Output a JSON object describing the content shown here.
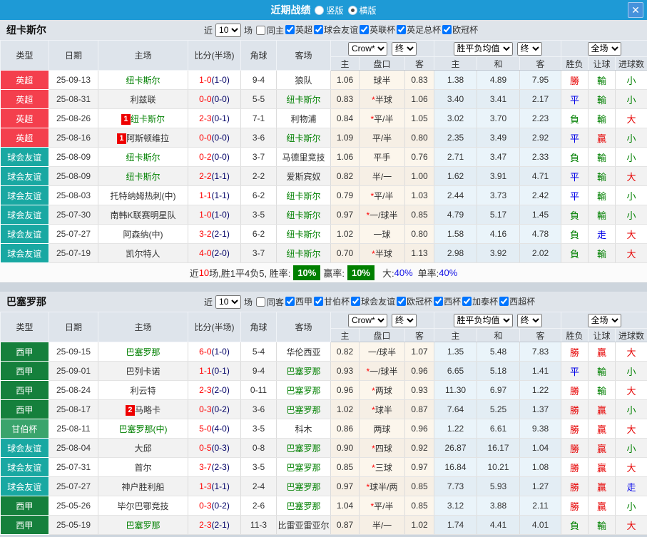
{
  "titlebar": {
    "title": "近期战绩",
    "vertical": "竖版",
    "horizontal": "横版",
    "close": "✕"
  },
  "colors": {
    "topbar_blue": "#1e9ad6",
    "epl_red": "#f43f4d",
    "friendly_teal": "#19a8a2",
    "laliga_green": "#15803c",
    "gamper_green": "#3aa46c",
    "win_red": "#e60000",
    "lose_green": "#008000",
    "draw_blue": "#0000e8"
  },
  "table_columns": {
    "main": [
      "类型",
      "日期",
      "主场",
      "比分(半场)",
      "角球",
      "客场"
    ],
    "sub": [
      "主",
      "盘口",
      "客",
      "主",
      "和",
      "客",
      "胜负",
      "让球",
      "进球数"
    ]
  },
  "sections": [
    {
      "team": "纽卡斯尔",
      "filter": {
        "near": "近",
        "count": "10",
        "unit": "场",
        "same": "同主",
        "leagues": [
          "英超",
          "球会友谊",
          "英联杯",
          "英足总杯",
          "欧冠杯"
        ]
      },
      "controls": {
        "bookmaker": "Crow*",
        "book_period": "终",
        "avg_label": "胜平负均值",
        "avg_period": "终",
        "scope": "全场"
      },
      "rows": [
        {
          "type": "英超",
          "type_color": "#f43f4d",
          "date": "25-09-13",
          "home": "纽卡斯尔",
          "home_green": true,
          "score": "1-0",
          "half": "(1-0)",
          "corner": "9-4",
          "away": "狼队",
          "away_green": false,
          "oh": "1.06",
          "hc": "球半",
          "oa": "0.83",
          "ah": "1.38",
          "ad": "4.89",
          "aa": "7.95",
          "res": "勝",
          "res_color": "#e60000",
          "let": "輸",
          "let_color": "#008000",
          "goal": "小",
          "goal_color": "#008000"
        },
        {
          "type": "英超",
          "type_color": "#f43f4d",
          "date": "25-08-31",
          "home": "利兹联",
          "home_green": false,
          "score": "0-0",
          "half": "(0-0)",
          "corner": "5-5",
          "away": "纽卡斯尔",
          "away_green": true,
          "oh": "0.83",
          "star": "*",
          "hc": "半球",
          "oa": "1.06",
          "ah": "3.40",
          "ad": "3.41",
          "aa": "2.17",
          "res": "平",
          "res_color": "#0000e8",
          "let": "輸",
          "let_color": "#008000",
          "goal": "小",
          "goal_color": "#008000"
        },
        {
          "type": "英超",
          "type_color": "#f43f4d",
          "date": "25-08-26",
          "badge": "1",
          "home": "纽卡斯尔",
          "home_green": true,
          "score": "2-3",
          "half": "(0-1)",
          "corner": "7-1",
          "away": "利物浦",
          "away_green": false,
          "oh": "0.84",
          "star": "*",
          "hc": "平/半",
          "oa": "1.05",
          "ah": "3.02",
          "ad": "3.70",
          "aa": "2.23",
          "res": "負",
          "res_color": "#008000",
          "let": "輸",
          "let_color": "#008000",
          "goal": "大",
          "goal_color": "#e60000"
        },
        {
          "type": "英超",
          "type_color": "#f43f4d",
          "date": "25-08-16",
          "badge": "1",
          "home": "阿斯顿维拉",
          "home_green": false,
          "score": "0-0",
          "half": "(0-0)",
          "corner": "3-6",
          "away": "纽卡斯尔",
          "away_green": true,
          "oh": "1.09",
          "hc": "平/半",
          "oa": "0.80",
          "ah": "2.35",
          "ad": "3.49",
          "aa": "2.92",
          "res": "平",
          "res_color": "#0000e8",
          "let": "贏",
          "let_color": "#e60000",
          "goal": "小",
          "goal_color": "#008000"
        },
        {
          "type": "球会友谊",
          "type_color": "#19a8a2",
          "date": "25-08-09",
          "home": "纽卡斯尔",
          "home_green": true,
          "score": "0-2",
          "half": "(0-0)",
          "corner": "3-7",
          "away": "马德里竞技",
          "away_green": false,
          "oh": "1.06",
          "hc": "平手",
          "oa": "0.76",
          "ah": "2.71",
          "ad": "3.47",
          "aa": "2.33",
          "res": "負",
          "res_color": "#008000",
          "let": "輸",
          "let_color": "#008000",
          "goal": "小",
          "goal_color": "#008000"
        },
        {
          "type": "球会友谊",
          "type_color": "#19a8a2",
          "date": "25-08-09",
          "home": "纽卡斯尔",
          "home_green": true,
          "score": "2-2",
          "half": "(1-1)",
          "corner": "2-2",
          "away": "爱斯宾奴",
          "away_green": false,
          "oh": "0.82",
          "hc": "半/一",
          "oa": "1.00",
          "ah": "1.62",
          "ad": "3.91",
          "aa": "4.71",
          "res": "平",
          "res_color": "#0000e8",
          "let": "輸",
          "let_color": "#008000",
          "goal": "大",
          "goal_color": "#e60000"
        },
        {
          "type": "球会友谊",
          "type_color": "#19a8a2",
          "date": "25-08-03",
          "home": "托特纳姆热刺(中)",
          "home_green": false,
          "score": "1-1",
          "half": "(1-1)",
          "corner": "6-2",
          "away": "纽卡斯尔",
          "away_green": true,
          "oh": "0.79",
          "star": "*",
          "hc": "平/半",
          "oa": "1.03",
          "ah": "2.44",
          "ad": "3.73",
          "aa": "2.42",
          "res": "平",
          "res_color": "#0000e8",
          "let": "輸",
          "let_color": "#008000",
          "goal": "小",
          "goal_color": "#008000"
        },
        {
          "type": "球会友谊",
          "type_color": "#19a8a2",
          "date": "25-07-30",
          "home": "南韩K联赛明星队",
          "home_green": false,
          "score": "1-0",
          "half": "(1-0)",
          "corner": "3-5",
          "away": "纽卡斯尔",
          "away_green": true,
          "oh": "0.97",
          "star": "*",
          "hc": "一/球半",
          "oa": "0.85",
          "ah": "4.79",
          "ad": "5.17",
          "aa": "1.45",
          "res": "負",
          "res_color": "#008000",
          "let": "輸",
          "let_color": "#008000",
          "goal": "小",
          "goal_color": "#008000"
        },
        {
          "type": "球会友谊",
          "type_color": "#19a8a2",
          "date": "25-07-27",
          "home": "阿森纳(中)",
          "home_green": false,
          "score": "3-2",
          "half": "(2-1)",
          "corner": "6-2",
          "away": "纽卡斯尔",
          "away_green": true,
          "oh": "1.02",
          "hc": "一球",
          "oa": "0.80",
          "ah": "1.58",
          "ad": "4.16",
          "aa": "4.78",
          "res": "負",
          "res_color": "#008000",
          "let": "走",
          "let_color": "#0000e8",
          "goal": "大",
          "goal_color": "#e60000"
        },
        {
          "type": "球会友谊",
          "type_color": "#19a8a2",
          "date": "25-07-19",
          "home": "凯尔特人",
          "home_green": false,
          "score": "4-0",
          "half": "(2-0)",
          "corner": "3-7",
          "away": "纽卡斯尔",
          "away_green": true,
          "oh": "0.70",
          "star": "*",
          "hc": "半球",
          "oa": "1.13",
          "ah": "2.98",
          "ad": "3.92",
          "aa": "2.02",
          "res": "負",
          "res_color": "#008000",
          "let": "輸",
          "let_color": "#008000",
          "goal": "大",
          "goal_color": "#e60000"
        }
      ],
      "summary": {
        "t1": "近",
        "count": "10",
        "t2": "场,胜1平4负5, 胜率:",
        "rate1": "10%",
        "t3": "赢率:",
        "rate2": "10%",
        "t4": "大:",
        "big": "40%",
        "t5": "单率:",
        "single": "40%"
      }
    },
    {
      "team": "巴塞罗那",
      "filter": {
        "near": "近",
        "count": "10",
        "unit": "场",
        "same": "同客",
        "leagues": [
          "西甲",
          "甘伯杯",
          "球会友谊",
          "欧冠杯",
          "西杯",
          "加泰杯",
          "西超杯"
        ]
      },
      "controls": {
        "bookmaker": "Crow*",
        "book_period": "终",
        "avg_label": "胜平负均值",
        "avg_period": "终",
        "scope": "全场"
      },
      "rows": [
        {
          "type": "西甲",
          "type_color": "#15803c",
          "date": "25-09-15",
          "home": "巴塞罗那",
          "home_green": true,
          "score": "6-0",
          "half": "(1-0)",
          "corner": "5-4",
          "away": "华伦西亚",
          "away_green": false,
          "oh": "0.82",
          "hc": "一/球半",
          "oa": "1.07",
          "ah": "1.35",
          "ad": "5.48",
          "aa": "7.83",
          "res": "勝",
          "res_color": "#e60000",
          "let": "贏",
          "let_color": "#e60000",
          "goal": "大",
          "goal_color": "#e60000"
        },
        {
          "type": "西甲",
          "type_color": "#15803c",
          "date": "25-09-01",
          "home": "巴列卡诺",
          "home_green": false,
          "score": "1-1",
          "half": "(0-1)",
          "corner": "9-4",
          "away": "巴塞罗那",
          "away_green": true,
          "oh": "0.93",
          "star": "*",
          "hc": "一/球半",
          "oa": "0.96",
          "ah": "6.65",
          "ad": "5.18",
          "aa": "1.41",
          "res": "平",
          "res_color": "#0000e8",
          "let": "輸",
          "let_color": "#008000",
          "goal": "小",
          "goal_color": "#008000"
        },
        {
          "type": "西甲",
          "type_color": "#15803c",
          "date": "25-08-24",
          "home": "利云特",
          "home_green": false,
          "score": "2-3",
          "half": "(2-0)",
          "corner": "0-11",
          "away": "巴塞罗那",
          "away_green": true,
          "oh": "0.96",
          "star": "*",
          "hc": "两球",
          "oa": "0.93",
          "ah": "11.30",
          "ad": "6.97",
          "aa": "1.22",
          "res": "勝",
          "res_color": "#e60000",
          "let": "輸",
          "let_color": "#008000",
          "goal": "大",
          "goal_color": "#e60000"
        },
        {
          "type": "西甲",
          "type_color": "#15803c",
          "date": "25-08-17",
          "badge": "2",
          "home": "马略卡",
          "home_green": false,
          "score": "0-3",
          "half": "(0-2)",
          "corner": "3-6",
          "away": "巴塞罗那",
          "away_green": true,
          "oh": "1.02",
          "star": "*",
          "hc": "球半",
          "oa": "0.87",
          "ah": "7.64",
          "ad": "5.25",
          "aa": "1.37",
          "res": "勝",
          "res_color": "#e60000",
          "let": "贏",
          "let_color": "#e60000",
          "goal": "小",
          "goal_color": "#008000"
        },
        {
          "type": "甘伯杯",
          "type_color": "#3aa46c",
          "date": "25-08-11",
          "home": "巴塞罗那(中)",
          "home_green": true,
          "score": "5-0",
          "half": "(4-0)",
          "corner": "3-5",
          "away": "科木",
          "away_green": false,
          "oh": "0.86",
          "hc": "两球",
          "oa": "0.96",
          "ah": "1.22",
          "ad": "6.61",
          "aa": "9.38",
          "res": "勝",
          "res_color": "#e60000",
          "let": "贏",
          "let_color": "#e60000",
          "goal": "大",
          "goal_color": "#e60000"
        },
        {
          "type": "球会友谊",
          "type_color": "#19a8a2",
          "date": "25-08-04",
          "home": "大邱",
          "home_green": false,
          "score": "0-5",
          "half": "(0-3)",
          "corner": "0-8",
          "away": "巴塞罗那",
          "away_green": true,
          "oh": "0.90",
          "star": "*",
          "hc": "四球",
          "oa": "0.92",
          "ah": "26.87",
          "ad": "16.17",
          "aa": "1.04",
          "res": "勝",
          "res_color": "#e60000",
          "let": "贏",
          "let_color": "#e60000",
          "goal": "小",
          "goal_color": "#008000"
        },
        {
          "type": "球会友谊",
          "type_color": "#19a8a2",
          "date": "25-07-31",
          "home": "首尔",
          "home_green": false,
          "score": "3-7",
          "half": "(2-3)",
          "corner": "3-5",
          "away": "巴塞罗那",
          "away_green": true,
          "oh": "0.85",
          "star": "*",
          "hc": "三球",
          "oa": "0.97",
          "ah": "16.84",
          "ad": "10.21",
          "aa": "1.08",
          "res": "勝",
          "res_color": "#e60000",
          "let": "贏",
          "let_color": "#e60000",
          "goal": "大",
          "goal_color": "#e60000"
        },
        {
          "type": "球会友谊",
          "type_color": "#19a8a2",
          "date": "25-07-27",
          "home": "神户胜利船",
          "home_green": false,
          "score": "1-3",
          "half": "(1-1)",
          "corner": "2-4",
          "away": "巴塞罗那",
          "away_green": true,
          "oh": "0.97",
          "star": "*",
          "hc": "球半/两",
          "oa": "0.85",
          "ah": "7.73",
          "ad": "5.93",
          "aa": "1.27",
          "res": "勝",
          "res_color": "#e60000",
          "let": "贏",
          "let_color": "#e60000",
          "goal": "走",
          "goal_color": "#0000e8"
        },
        {
          "type": "西甲",
          "type_color": "#15803c",
          "date": "25-05-26",
          "home": "毕尔巴鄂竞技",
          "home_green": false,
          "score": "0-3",
          "half": "(0-2)",
          "corner": "2-6",
          "away": "巴塞罗那",
          "away_green": true,
          "oh": "1.04",
          "star": "*",
          "hc": "平/半",
          "oa": "0.85",
          "ah": "3.12",
          "ad": "3.88",
          "aa": "2.11",
          "res": "勝",
          "res_color": "#e60000",
          "let": "贏",
          "let_color": "#e60000",
          "goal": "小",
          "goal_color": "#008000"
        },
        {
          "type": "西甲",
          "type_color": "#15803c",
          "date": "25-05-19",
          "home": "巴塞罗那",
          "home_green": true,
          "score": "2-3",
          "half": "(2-1)",
          "corner": "11-3",
          "away": "比雷亚雷亚尔",
          "away_green": false,
          "oh": "0.87",
          "hc": "半/一",
          "oa": "1.02",
          "ah": "1.74",
          "ad": "4.41",
          "aa": "4.01",
          "res": "負",
          "res_color": "#008000",
          "let": "輸",
          "let_color": "#008000",
          "goal": "大",
          "goal_color": "#e60000"
        }
      ]
    }
  ]
}
